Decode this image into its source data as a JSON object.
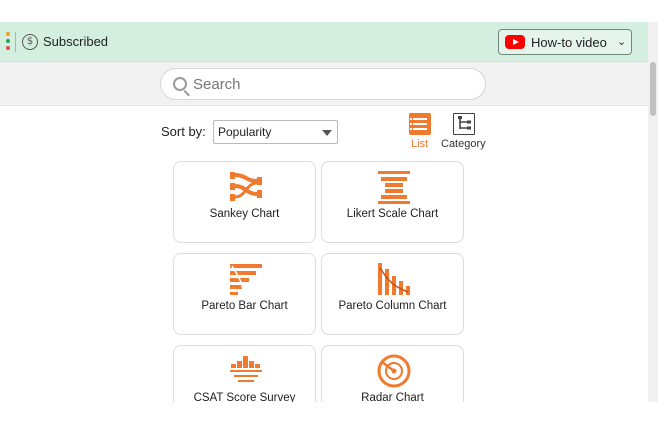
{
  "topbar": {
    "subscribed_label": "Subscribed",
    "subscribed_icon": "dollar-circle-icon",
    "howto_label": "How-to video",
    "howto_icon": "youtube-icon"
  },
  "search": {
    "placeholder": "Search",
    "value": ""
  },
  "sort": {
    "label": "Sort by:",
    "selected": "Popularity"
  },
  "views": [
    {
      "label": "List",
      "active": true,
      "icon": "list-icon"
    },
    {
      "label": "Category",
      "active": false,
      "icon": "category-tree-icon"
    }
  ],
  "charts": [
    {
      "label": "Sankey Chart",
      "icon": "sankey-chart-icon"
    },
    {
      "label": "Likert Scale Chart",
      "icon": "likert-scale-icon"
    },
    {
      "label": "Pareto Bar Chart",
      "icon": "pareto-bar-icon"
    },
    {
      "label": "Pareto Column Chart",
      "icon": "pareto-column-icon"
    },
    {
      "label": "CSAT Score Survey",
      "icon": "csat-score-icon"
    },
    {
      "label": "Radar Chart",
      "icon": "radar-chart-icon"
    }
  ],
  "colors": {
    "accent": "#f07a2e",
    "topbar_bg": "#d4efe0",
    "youtube_red": "#ff0000"
  }
}
